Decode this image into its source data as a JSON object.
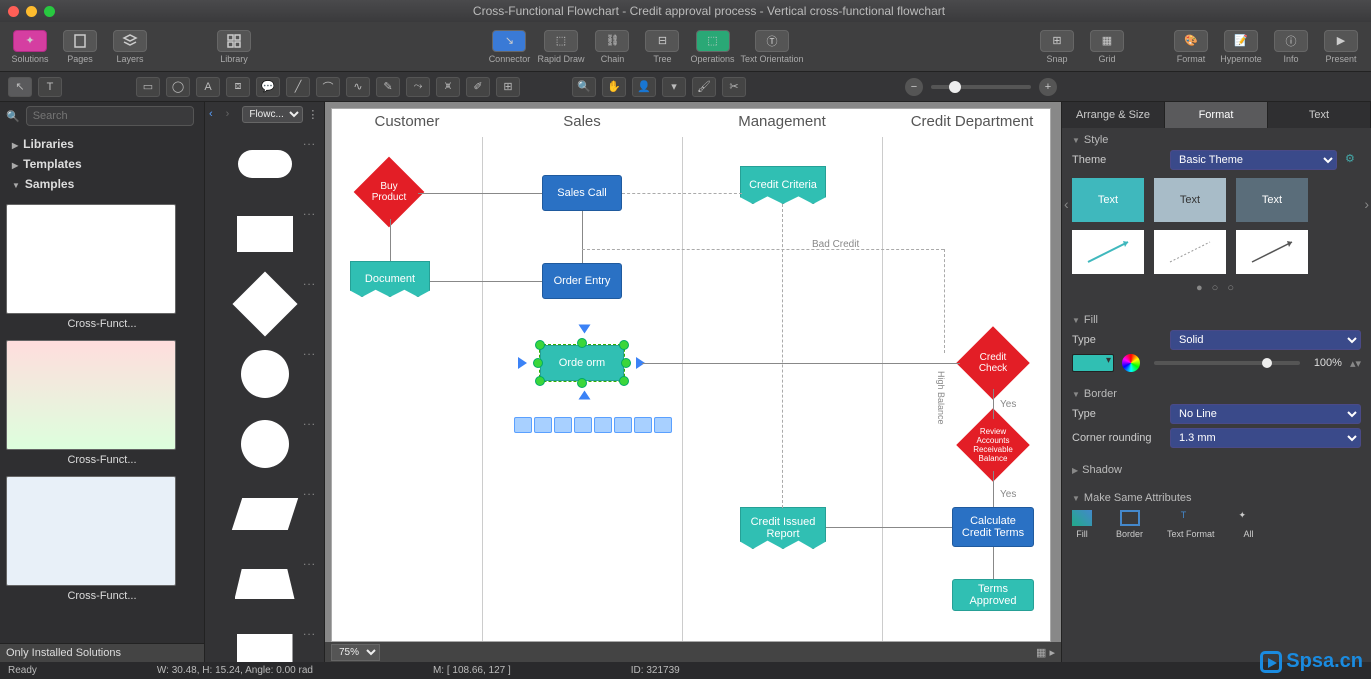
{
  "window": {
    "title": "Cross-Functional Flowchart - Credit approval process - Vertical cross-functional flowchart"
  },
  "toolbar": {
    "solutions": "Solutions",
    "pages": "Pages",
    "layers": "Layers",
    "library": "Library",
    "connector": "Connector",
    "rapidDraw": "Rapid Draw",
    "chain": "Chain",
    "tree": "Tree",
    "operations": "Operations",
    "textOrientation": "Text Orientation",
    "snap": "Snap",
    "grid": "Grid",
    "formatTool": "Format",
    "hypernote": "Hypernote",
    "info": "Info",
    "present": "Present"
  },
  "left": {
    "searchPlaceholder": "Search",
    "libraries": "Libraries",
    "templates": "Templates",
    "samples": "Samples",
    "thumb1": "Cross-Funct...",
    "thumb2": "Cross-Funct...",
    "thumb3": "Cross-Funct...",
    "footer": "Only Installed Solutions"
  },
  "palette": {
    "dropdown": "Flowc..."
  },
  "canvas": {
    "lanes": [
      "Customer",
      "Sales",
      "Management",
      "Credit Department"
    ],
    "shapes": {
      "buyProduct": "Buy Product",
      "document": "Document",
      "salesCall": "Sales Call",
      "orderEntry": "Order Entry",
      "orderForm": "Orde   orm",
      "creditCriteria": "Credit Criteria",
      "creditCheck": "Credit Check",
      "reviewAccounts": "Review Accounts Receivable Balance",
      "calcTerms": "Calculate Credit Terms",
      "termsApproved": "Terms Approved",
      "creditIssued": "Credit Issued Report"
    },
    "labels": {
      "badCredit": "Bad Credit",
      "highBalance": "High Balance",
      "yes1": "Yes",
      "yes2": "Yes"
    },
    "zoom": "75%"
  },
  "right": {
    "tabArrange": "Arrange & Size",
    "tabFormat": "Format",
    "tabText": "Text",
    "style": "Style",
    "theme": "Theme",
    "themeValue": "Basic Theme",
    "cardText": "Text",
    "fill": "Fill",
    "fillType": "Type",
    "fillTypeValue": "Solid",
    "opacity": "100%",
    "border": "Border",
    "borderType": "Type",
    "borderTypeValue": "No Line",
    "cornerRounding": "Corner rounding",
    "cornerValue": "1.3 mm",
    "shadow": "Shadow",
    "makeSame": "Make Same Attributes",
    "attrFill": "Fill",
    "attrBorder": "Border",
    "attrText": "Text Format",
    "attrAll": "All"
  },
  "status": {
    "ready": "Ready",
    "dims": "W: 30.48,  H: 15.24,  Angle: 0.00 rad",
    "mouse": "M: [ 108.66, 127 ]",
    "id": "ID: 321739"
  },
  "watermark": "Spsa.cn"
}
